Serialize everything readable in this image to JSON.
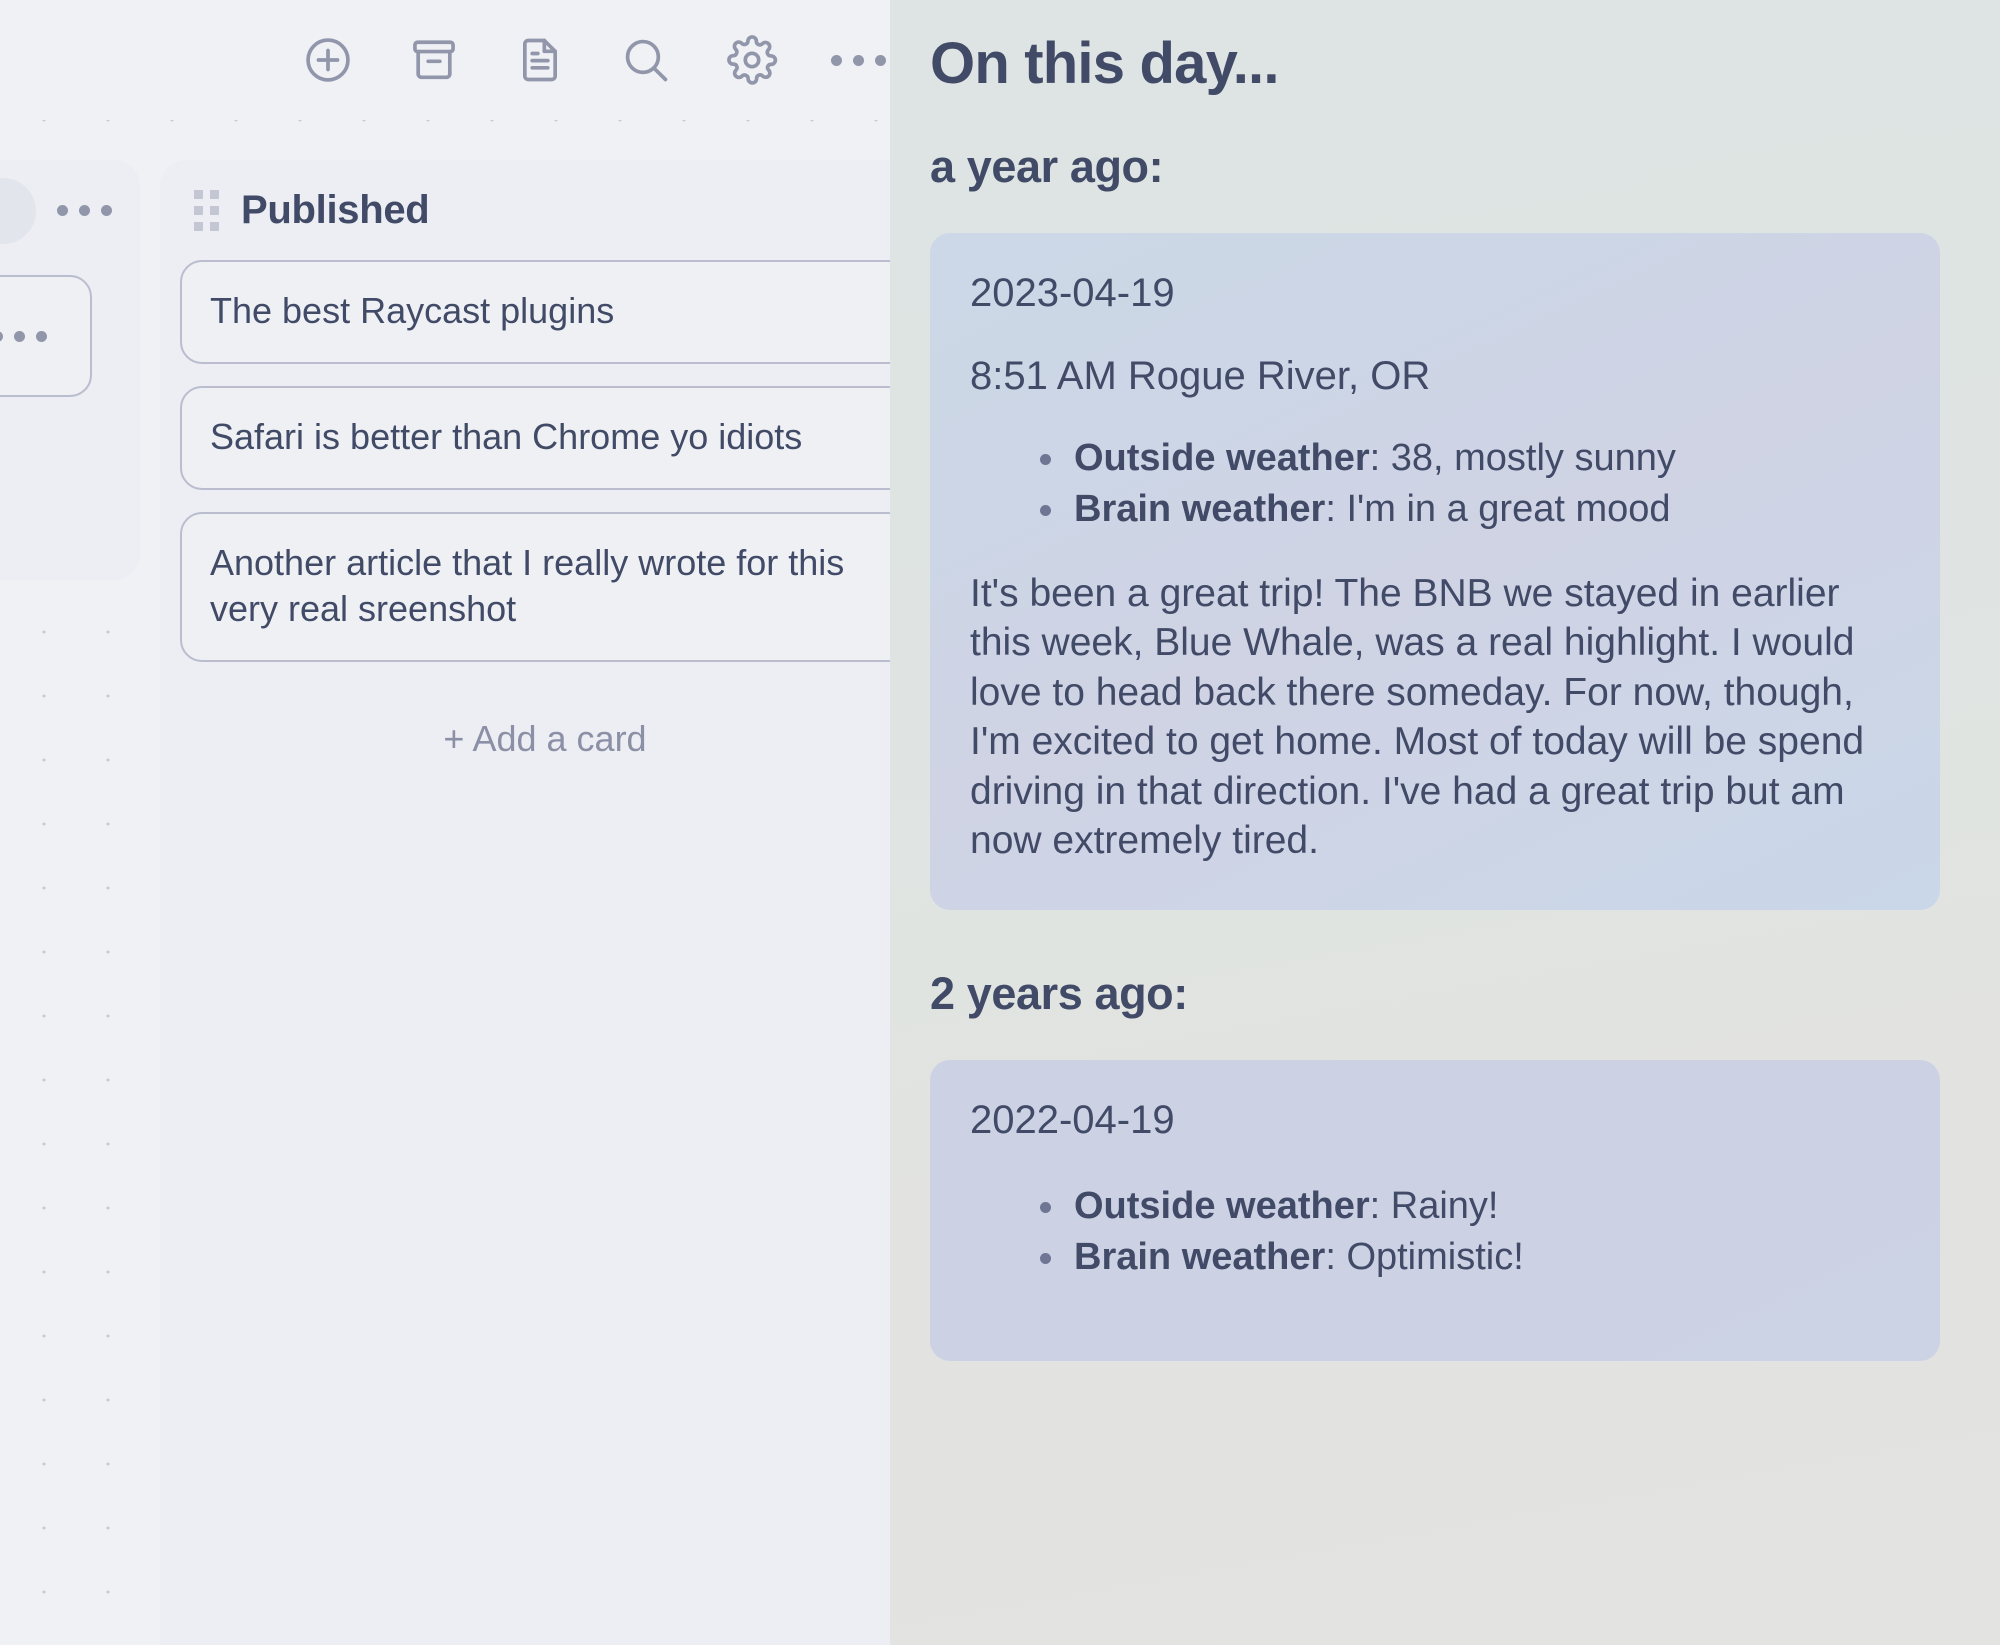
{
  "toolbar": {
    "icons": [
      {
        "name": "add-circle-icon",
        "label": "Add"
      },
      {
        "name": "archive-icon",
        "label": "Archive"
      },
      {
        "name": "document-icon",
        "label": "Document"
      },
      {
        "name": "search-icon",
        "label": "Search"
      },
      {
        "name": "gear-icon",
        "label": "Settings"
      },
      {
        "name": "more-icon",
        "label": "More"
      }
    ]
  },
  "board": {
    "partial_column": {
      "menu_label": "•••",
      "card_menu_label": "•••"
    },
    "column": {
      "title": "Published",
      "drag_handle": "drag-handle",
      "cards": [
        {
          "title": "The best Raycast plugins"
        },
        {
          "title": "Safari is better than Chrome yo idiots"
        },
        {
          "title": "Another article that I really wrote for this very real sreenshot"
        }
      ],
      "add_card_label": "+ Add a card"
    }
  },
  "panel": {
    "title": "On this day...",
    "sections": [
      {
        "heading": "a year ago:",
        "entry": {
          "date": "2023-04-19",
          "location": "8:51 AM Rogue River, OR",
          "bullets": [
            {
              "label": "Outside weather",
              "value": "38, mostly sunny"
            },
            {
              "label": "Brain weather",
              "value": "I'm in a great mood"
            }
          ],
          "body": "It's been a great trip! The BNB we stayed in earlier this week, Blue Whale, was a real highlight. I would love to head back there someday. For now, though, I'm excited to get home. Most of today will be spend driving in that direction. I've had a great trip but am now extremely tired."
        }
      },
      {
        "heading": "2 years ago:",
        "entry": {
          "date": "2022-04-19",
          "location": "",
          "bullets": [
            {
              "label": "Outside weather",
              "value": "Rainy!"
            },
            {
              "label": "Brain weather",
              "value": "Optimistic!"
            }
          ],
          "body": ""
        }
      }
    ]
  },
  "colors": {
    "board_bg": "#eff1f5",
    "column_bg": "#eceef3",
    "card_border": "#b9bdcd",
    "text": "#414a66",
    "panel_bg": "#dfe4e2",
    "entry_bg": "#ccd6e6",
    "muted": "#8b90a6"
  }
}
